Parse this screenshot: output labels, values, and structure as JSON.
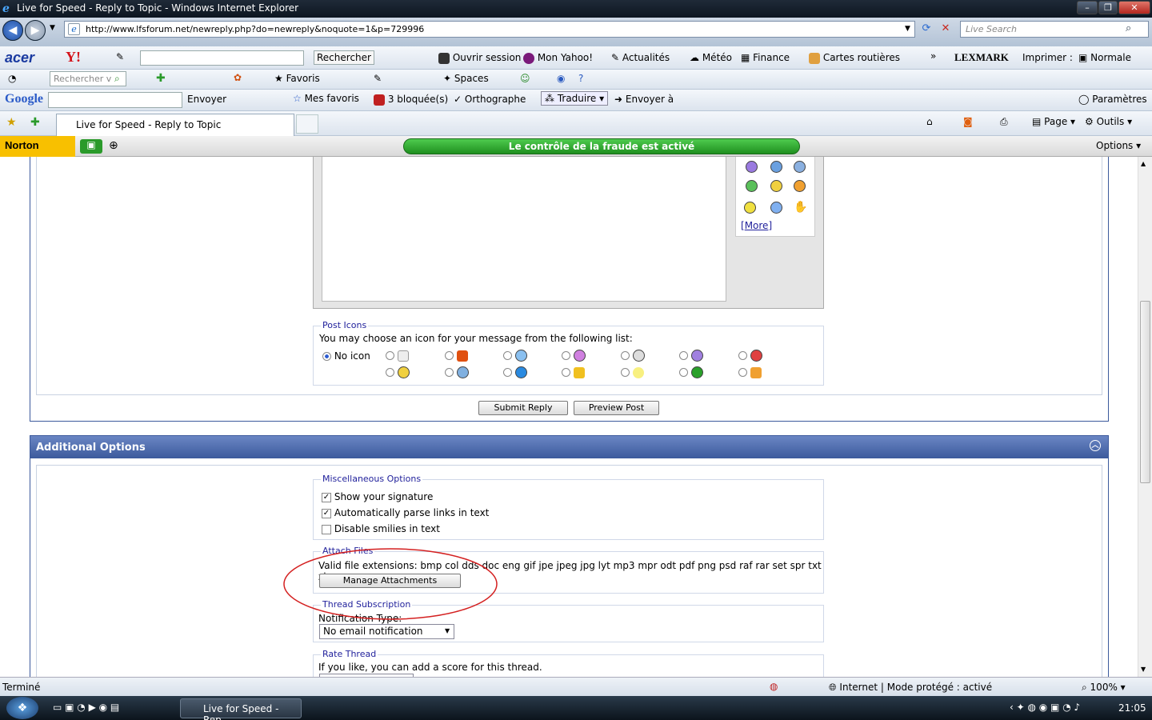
{
  "window": {
    "title": "Live for Speed - Reply to Topic - Windows Internet Explorer",
    "ie_glyph": "e"
  },
  "address": {
    "url": "http://www.lfsforum.net/newreply.php?do=newreply&noquote=1&p=729996",
    "search_placeholder": "Live Search"
  },
  "toolbar1": {
    "brand": "acer",
    "yahoo": "Y!",
    "rechercher": "Rechercher",
    "ouvrir": "Ouvrir session",
    "monyahoo": "Mon Yahoo!",
    "actualites": "Actualités",
    "meteo": "Météo",
    "finance": "Finance",
    "cartes": "Cartes routières",
    "more": "»",
    "lexmark": "LEXMARK",
    "imprimer": "Imprimer :",
    "normale": "Normale"
  },
  "toolbar2": {
    "search_placeholder": "Rechercher v",
    "envoyer": "Envoyer",
    "favoris": "Favoris",
    "spaces": "Spaces"
  },
  "toolbar3": {
    "google": "Google",
    "envoyer": "Envoyer",
    "mesfavoris": "Mes favoris",
    "bloquees": "3 bloquée(s)",
    "orthographe": "Orthographe",
    "traduire": "Traduire",
    "envoyera": "Envoyer à",
    "parametres": "Paramètres"
  },
  "tabsbar": {
    "tab_label": "Live for Speed - Reply to Topic",
    "page": "Page",
    "outils": "Outils"
  },
  "norton": {
    "logo": "Norton",
    "fraud": "Le contrôle de la fraude est activé",
    "options": "Options"
  },
  "smilies": {
    "more": "More"
  },
  "post_icons": {
    "legend": "Post Icons",
    "desc": "You may choose an icon for your message from the following list:",
    "no_icon": "No icon"
  },
  "buttons": {
    "submit": "Submit Reply",
    "preview": "Preview Post"
  },
  "additional": {
    "title": "Additional Options"
  },
  "misc": {
    "legend": "Miscellaneous Options",
    "sig": "Show your signature",
    "links": "Automatically parse links in text",
    "smilies": "Disable smilies in text"
  },
  "attach": {
    "legend": "Attach Files",
    "valid": "Valid file extensions: bmp col dds doc eng gif jpe jpeg jpg lyt mp3 mpr odt pdf png psd raf rar set spr txt zip",
    "manage": "Manage Attachments"
  },
  "thread_sub": {
    "legend": "Thread Subscription",
    "label": "Notification Type:",
    "value": "No email notification"
  },
  "rate": {
    "legend": "Rate Thread",
    "desc": "If you like, you can add a score for this thread."
  },
  "status": {
    "left": "Terminé",
    "zone": "Internet | Mode protégé : activé",
    "zoom": "100%"
  },
  "taskbar": {
    "task": "Live for Speed - Rep...",
    "clock": "21:05"
  },
  "colors": {
    "header_blue": "#3c5a9c",
    "annotation": "#d42020"
  }
}
